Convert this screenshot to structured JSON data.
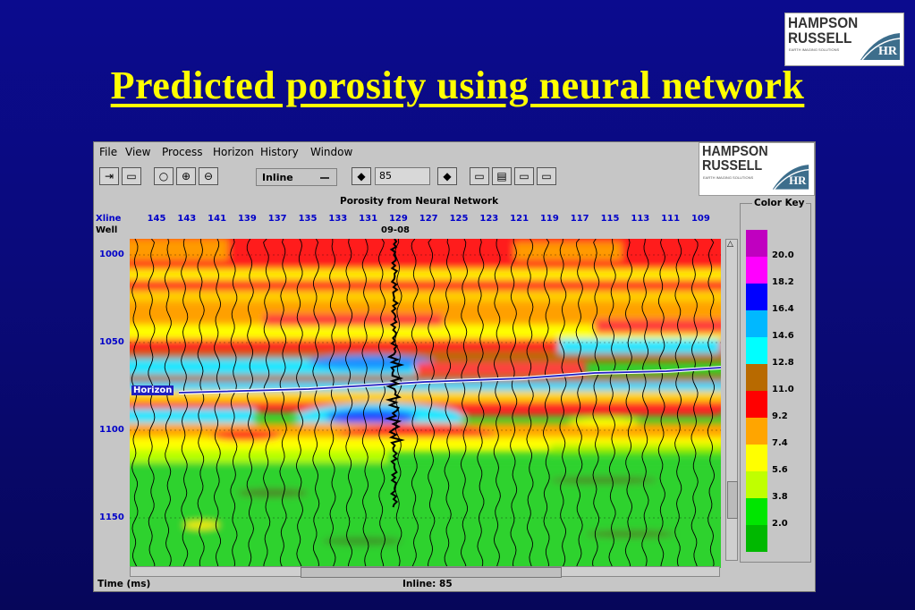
{
  "slide": {
    "title": "Predicted porosity using neural network",
    "logo": {
      "line1": "HAMPSON",
      "line2": "RUSSELL",
      "tagline": "EARTH IMAGING SOLUTIONS",
      "mark": "HR"
    }
  },
  "app": {
    "menu": [
      "File",
      "View",
      "Process",
      "Horizon",
      "History",
      "Window"
    ],
    "toolbar": {
      "icons": [
        "exit-icon",
        "open-folder-icon",
        "zoom-icon",
        "zoom-in-icon",
        "zoom-out-icon"
      ],
      "direction_select": "Inline",
      "line_number": "85",
      "view_icons": [
        "single-window-icon",
        "multi-window-icon",
        "scroll-down-icon",
        "scroll-up-icon"
      ]
    },
    "logo": {
      "line1": "HAMPSON",
      "line2": "RUSSELL",
      "tagline": "EARTH IMAGING SOLUTIONS",
      "mark": "HR"
    },
    "plot": {
      "title": "Porosity from Neural Network",
      "xline_label": "Xline",
      "well_label": "Well",
      "well_name": "09-08",
      "xline_ticks": [
        "145",
        "143",
        "141",
        "139",
        "137",
        "135",
        "133",
        "131",
        "129",
        "127",
        "125",
        "123",
        "121",
        "119",
        "117",
        "115",
        "113",
        "111",
        "109"
      ],
      "time_ticks": [
        "1000",
        "1050",
        "1100",
        "1150"
      ],
      "horizon_label": "Horizon"
    },
    "color_key": {
      "title": "Color Key",
      "colors": [
        "#c000c0",
        "#ff00ff",
        "#0000ff",
        "#00b8ff",
        "#00ffff",
        "#b86a00",
        "#ff0000",
        "#ffa500",
        "#ffff00",
        "#c0ff00",
        "#00e600",
        "#00b800"
      ],
      "labels": [
        "20.0",
        "18.2",
        "16.4",
        "14.6",
        "12.8",
        "11.0",
        "9.2",
        "7.4",
        "5.6",
        "3.8",
        "2.0"
      ]
    },
    "status": {
      "left": "Time (ms)",
      "center": "Inline: 85"
    }
  }
}
